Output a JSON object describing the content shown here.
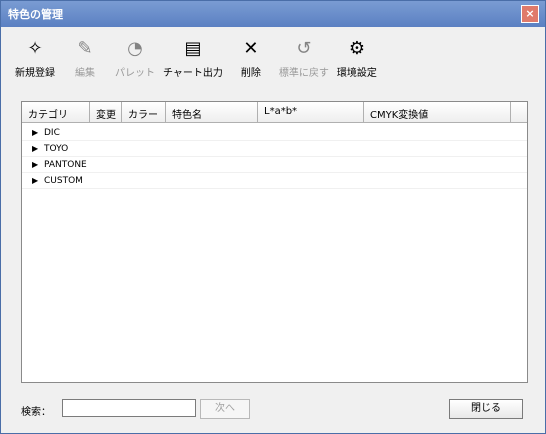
{
  "window": {
    "title": "特色の管理",
    "close_icon": "close-icon"
  },
  "toolbar": [
    {
      "label": "新規登録",
      "icon": "new-icon",
      "enabled": true
    },
    {
      "label": "編集",
      "icon": "edit-icon",
      "enabled": false
    },
    {
      "label": "パレット",
      "icon": "palette-icon",
      "enabled": false
    },
    {
      "label": "チャート出力",
      "icon": "chart-output-icon",
      "enabled": true
    },
    {
      "label": "削除",
      "icon": "delete-icon",
      "enabled": true
    },
    {
      "label": "標準に戻す",
      "icon": "restore-icon",
      "enabled": false
    },
    {
      "label": "環境設定",
      "icon": "settings-icon",
      "enabled": true
    }
  ],
  "list": {
    "columns": [
      "カテゴリ",
      "変更",
      "カラー",
      "特色名",
      "L*a*b*",
      "CMYK変換値"
    ],
    "rows": [
      "DIC",
      "TOYO",
      "PANTONE",
      "CUSTOM"
    ]
  },
  "footer": {
    "search_label": "検索：",
    "search_value": "",
    "next_label": "次へ",
    "close_label": "閉じる"
  }
}
